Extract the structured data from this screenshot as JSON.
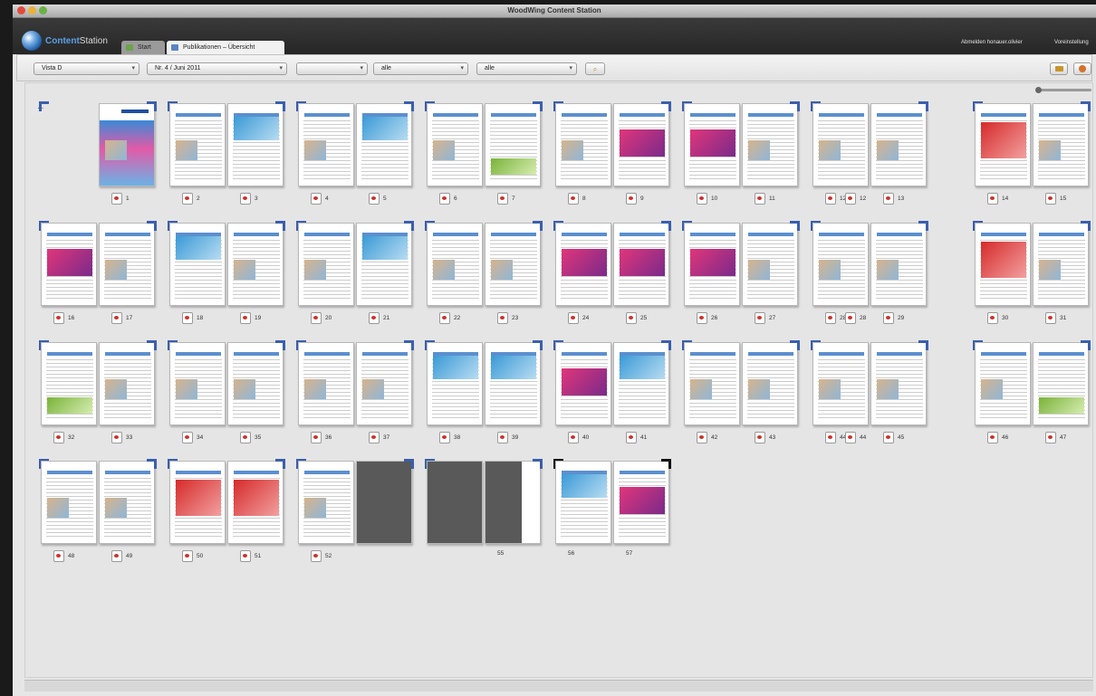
{
  "window": {
    "title": "WoodWing Content Station"
  },
  "app": {
    "logo_part1": "Content",
    "logo_part2": "Station"
  },
  "tabs": [
    {
      "label": "Start"
    },
    {
      "label": "Publikationen – Übersicht"
    }
  ],
  "header": {
    "logout": "Abmelden honauer.olivier",
    "settings": "Voreinstellung"
  },
  "filters": {
    "publication": "Vista D",
    "issue": "Nr. 4 / Juni 2011",
    "section": "",
    "status": "alle",
    "user": "alle"
  },
  "spreads": [
    {
      "left": "",
      "right": "1"
    },
    {
      "left": "2",
      "right": "3"
    },
    {
      "left": "4",
      "right": "5"
    },
    {
      "left": "6",
      "right": "7"
    },
    {
      "left": "8",
      "right": "9"
    },
    {
      "left": "10",
      "right": "11"
    },
    {
      "left": "12",
      "right": "13",
      "extra": "12"
    },
    {
      "left": "14",
      "right": "15"
    },
    {
      "left": "16",
      "right": "17"
    },
    {
      "left": "18",
      "right": "19"
    },
    {
      "left": "20",
      "right": "21"
    },
    {
      "left": "22",
      "right": "23"
    },
    {
      "left": "24",
      "right": "25"
    },
    {
      "left": "26",
      "right": "27"
    },
    {
      "left": "28",
      "right": "29",
      "extra": "28"
    },
    {
      "left": "30",
      "right": "31"
    },
    {
      "left": "32",
      "right": "33"
    },
    {
      "left": "34",
      "right": "35"
    },
    {
      "left": "36",
      "right": "37"
    },
    {
      "left": "38",
      "right": "39"
    },
    {
      "left": "40",
      "right": "41"
    },
    {
      "left": "42",
      "right": "43"
    },
    {
      "left": "44",
      "right": "45",
      "extra": "44"
    },
    {
      "left": "46",
      "right": "47"
    },
    {
      "left": "48",
      "right": "49"
    },
    {
      "left": "50",
      "right": "51"
    },
    {
      "left": "52",
      "right": ""
    },
    {
      "left": "",
      "right": "55"
    },
    {
      "left": "56",
      "right": "57"
    }
  ]
}
